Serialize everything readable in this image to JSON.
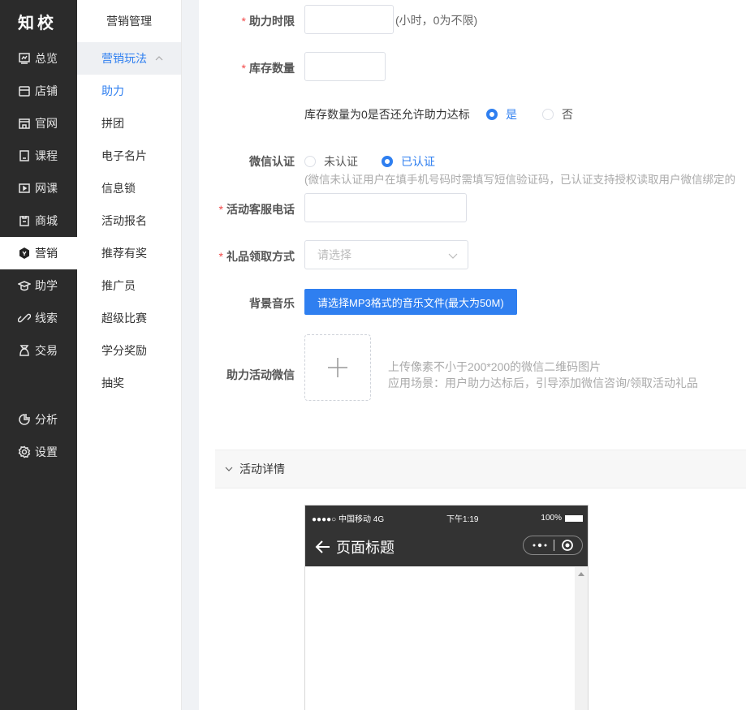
{
  "brand": {
    "logo": "知校"
  },
  "nav": {
    "items": [
      {
        "label": "总览",
        "icon": "dashboard-icon"
      },
      {
        "label": "店铺",
        "icon": "store-icon"
      },
      {
        "label": "官网",
        "icon": "website-icon"
      },
      {
        "label": "课程",
        "icon": "course-icon"
      },
      {
        "label": "网课",
        "icon": "video-icon"
      },
      {
        "label": "商城",
        "icon": "mall-icon"
      },
      {
        "label": "营销",
        "icon": "marketing-icon"
      },
      {
        "label": "助学",
        "icon": "study-icon"
      },
      {
        "label": "线索",
        "icon": "leads-icon"
      },
      {
        "label": "交易",
        "icon": "trade-icon"
      }
    ],
    "bottom": [
      {
        "label": "分析",
        "icon": "analysis-icon"
      },
      {
        "label": "设置",
        "icon": "settings-icon"
      }
    ],
    "active": "营销"
  },
  "subnav": {
    "title": "营销管理",
    "group": "营销玩法",
    "items": [
      "助力",
      "拼团",
      "电子名片",
      "信息锁",
      "活动报名",
      "推荐有奖",
      "推广员",
      "超级比赛",
      "学分奖励",
      "抽奖"
    ],
    "active": "助力"
  },
  "form": {
    "time_limit": {
      "label": "助力时限",
      "value": "",
      "hint": "(小时，0为不限)"
    },
    "stock": {
      "label": "库存数量",
      "value": ""
    },
    "stock_zero": {
      "question": "库存数量为0是否还允许助力达标",
      "yes": "是",
      "no": "否",
      "selected": "是"
    },
    "wechat_auth": {
      "label": "微信认证",
      "opt1": "未认证",
      "opt2": "已认证",
      "selected": "已认证",
      "hint": "(微信未认证用户在填手机号码时需填写短信验证码，已认证支持授权读取用户微信绑定的"
    },
    "service_phone": {
      "label": "活动客服电话",
      "value": ""
    },
    "gift_method": {
      "label": "礼品领取方式",
      "placeholder": "请选择"
    },
    "bg_music": {
      "label": "背景音乐",
      "button": "请选择MP3格式的音乐文件(最大为50M)"
    },
    "wechat_qr": {
      "label": "助力活动微信",
      "hint1": "上传像素不小于200*200的微信二维码图片",
      "hint2": "应用场景：用户助力达标后，引导添加微信咨询/领取活动礼品"
    }
  },
  "details": {
    "title": "活动详情"
  },
  "phone": {
    "carrier": "●●●●○ 中国移动  4G",
    "time": "下午1:19",
    "battery": "100%",
    "title": "页面标题"
  },
  "colors": {
    "primary": "#2f7ff0",
    "nav_bg": "#2b2b2b",
    "required": "#f24a4a"
  }
}
